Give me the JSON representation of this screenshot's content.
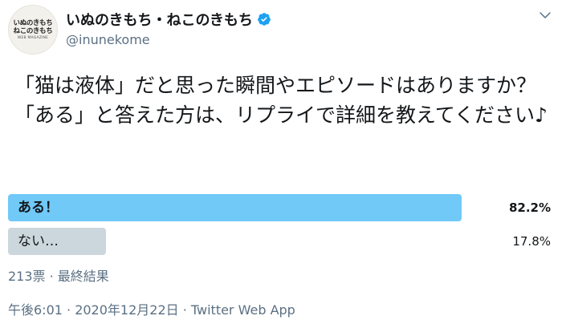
{
  "avatar": {
    "line1": "いぬのきもち",
    "line2": "ねこのきもち",
    "line3": "WEB MAGAZINE"
  },
  "author": {
    "display_name": "いぬのきもち・ねこのきもち",
    "handle": "@inunekome",
    "verified": true
  },
  "tweet": {
    "text": "「猫は液体」だと思った瞬間やエピソードはありますか？\n「ある」と答えた方は、リプライで詳細を教えてください♪"
  },
  "poll": {
    "options": [
      {
        "label": "ある！",
        "percent": "82.2%",
        "value": 82.2,
        "winner": true
      },
      {
        "label": "ない…",
        "percent": "17.8%",
        "value": 17.8,
        "winner": false
      }
    ],
    "meta": "213票 · 最終結果"
  },
  "footer": {
    "timestamp": "午後6:01 · 2020年12月22日 · Twitter Web App"
  },
  "colors": {
    "winner_bar": "#71c9f8",
    "loser_bar": "#ccd6dd",
    "verified_badge": "#1da1f2",
    "secondary_text": "#5b7083"
  },
  "icons": {
    "verified": "verified-badge-icon",
    "more": "chevron-down-icon"
  }
}
